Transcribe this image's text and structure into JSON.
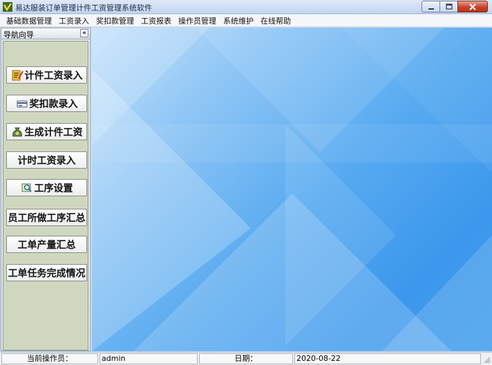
{
  "window": {
    "title": "易达服装订单管理计件工资管理系统软件",
    "controls": [
      "minimize",
      "maximize",
      "close"
    ]
  },
  "menu": [
    "基础数据管理",
    "工资录入",
    "奖扣款管理",
    "工资报表",
    "操作员管理",
    "系统维护",
    "在线帮助"
  ],
  "sidebar": {
    "header": "导航向导",
    "collapse_glyph": "«",
    "buttons": [
      {
        "label": "计件工资录入",
        "icon": "notepad-icon"
      },
      {
        "label": "奖扣款录入",
        "icon": "card-icon"
      },
      {
        "label": "生成计件工资",
        "icon": "money-bag-icon"
      },
      {
        "label": "计时工资录入",
        "icon": ""
      },
      {
        "label": "工序设置",
        "icon": "settings-search-icon"
      },
      {
        "label": "员工所做工序汇总",
        "icon": ""
      },
      {
        "label": "工单产量汇总",
        "icon": ""
      },
      {
        "label": "工单任务完成情况",
        "icon": ""
      }
    ]
  },
  "status": {
    "operator_label": "当前操作员：",
    "operator_value": "admin",
    "date_label": "日期：",
    "date_value": "2020-08-22"
  }
}
